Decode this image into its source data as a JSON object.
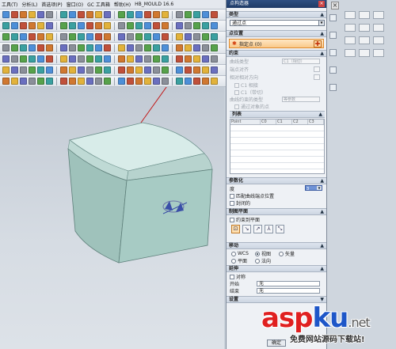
{
  "menubar": {
    "items": [
      "工具(T)",
      "分析(L)",
      "首选项(P)",
      "窗口(O)",
      "GC 工具箱",
      "帮助(H)",
      "HB_MOULD 16.6"
    ]
  },
  "toolbar_colors": [
    "#4d8fd8",
    "#e2b23a",
    "#57a24b",
    "#c0503a",
    "#6a6fbf",
    "#3aa0a0",
    "#d07830",
    "#8a8f99"
  ],
  "dialog": {
    "title": "点构造器",
    "type_section": "类型",
    "type_value": "通过点",
    "point_section": "点位置",
    "point_select": "指定点 (0)",
    "constraint_section": "约束",
    "constraint_type_label": "曲线类型",
    "constraint_type_value": "C1（相切）",
    "endpoint_label": "端点对齐",
    "ref_label": "相对相对方向",
    "opt1": "C1 相接",
    "opt2": "C1（带切）",
    "curve_label": "曲线约束的类型",
    "curve_value": "等参数",
    "point_opt": "通过对象的点",
    "list_section": "列表",
    "list_columns": [
      "Point",
      "C0",
      "C1",
      "C2",
      "C3"
    ],
    "param_section": "参数化",
    "degree_label": "度",
    "degree_value": "3",
    "cb_match": "匹配曲线端点位置",
    "cb_closed": "封闭的",
    "plane_section": "制图平面",
    "cb_plane": "约束到平面",
    "move_section": "移动",
    "move_wcs": "WCS",
    "move_view": "视图",
    "move_vector": "矢量",
    "move_plane": "平面",
    "move_normal": "法向",
    "extend_section": "延伸",
    "cb_extend": "对称",
    "start_label": "开始",
    "start_value": "无",
    "end_label": "结束",
    "end_value": "无",
    "settings_section": "设置",
    "ok_label": "确定"
  },
  "watermark": {
    "logo_red": "asp",
    "logo_blue": "ku",
    "logo_suffix": ".net",
    "tagline": "免费网站源码下载站!"
  },
  "colors": {
    "accent_orange": "#f9c88a",
    "title_blue": "#1e3a66",
    "model_face": "#a7cbc4"
  }
}
